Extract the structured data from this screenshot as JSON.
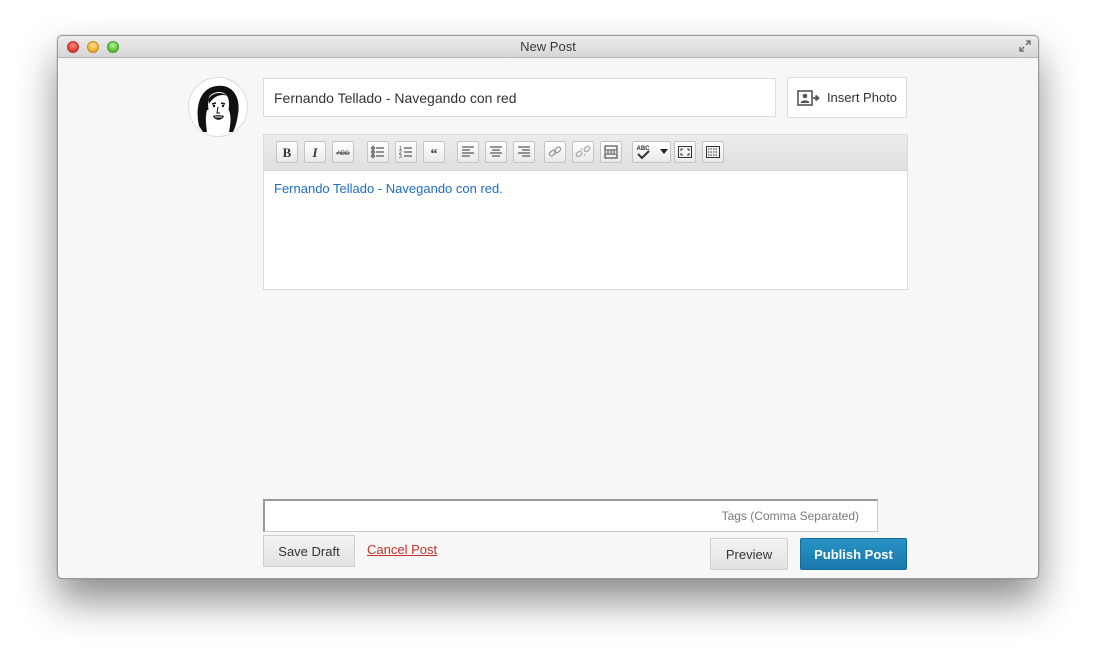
{
  "window": {
    "title": "New Post"
  },
  "post": {
    "title_value": "Fernando Tellado - Navegando con red",
    "body_text": "Fernando Tellado - Navegando con red.",
    "insert_photo_label": "Insert Photo"
  },
  "toolbar": {
    "buttons": [
      "bold",
      "italic",
      "strikethrough",
      "bulleted-list",
      "numbered-list",
      "blockquote",
      "align-left",
      "align-center",
      "align-right",
      "insert-link",
      "remove-link",
      "read-more",
      "spellcheck",
      "fullscreen",
      "kitchen-sink"
    ],
    "spellcheck_label": "ABC",
    "strikethrough_label": "ABC"
  },
  "tags": {
    "placeholder": "Tags (Comma Separated)",
    "value": ""
  },
  "actions": {
    "save_draft": "Save Draft",
    "cancel_post": "Cancel Post",
    "preview": "Preview",
    "publish": "Publish Post"
  },
  "colors": {
    "publish_bg": "#1a79ad",
    "cancel_link": "#c0322a",
    "body_text": "#1e6fc0"
  }
}
